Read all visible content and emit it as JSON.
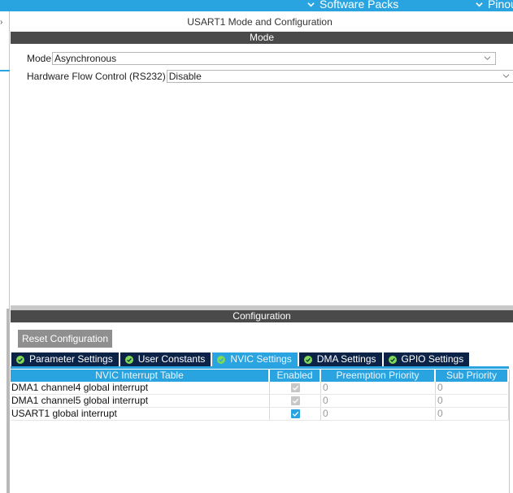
{
  "topbar": {
    "menu1": "Software Packs",
    "menu2": "Pinout",
    "accent": "#2aa4e0"
  },
  "panel": {
    "title": "USART1 Mode and Configuration",
    "mode_header": "Mode",
    "config_header": "Configuration"
  },
  "mode": {
    "mode_label": "Mode",
    "mode_value": "Asynchronous",
    "hfc_label": "Hardware Flow Control (RS232)",
    "hfc_value": "Disable"
  },
  "config": {
    "reset_label": "Reset Configuration",
    "tabs": [
      {
        "label": "Parameter Settings",
        "active": false
      },
      {
        "label": "User Constants",
        "active": false
      },
      {
        "label": "NVIC Settings",
        "active": true
      },
      {
        "label": "DMA Settings",
        "active": false
      },
      {
        "label": "GPIO Settings",
        "active": false
      }
    ]
  },
  "nvic": {
    "headers": [
      "NVIC Interrupt Table",
      "Enabled",
      "Preemption Priority",
      "Sub Priority"
    ],
    "rows": [
      {
        "name": "DMA1 channel4 global interrupt",
        "enabled": true,
        "editable": false,
        "preemption": "0",
        "sub": "0"
      },
      {
        "name": "DMA1 channel5 global interrupt",
        "enabled": true,
        "editable": false,
        "preemption": "0",
        "sub": "0"
      },
      {
        "name": "USART1 global interrupt",
        "enabled": true,
        "editable": true,
        "preemption": "0",
        "sub": "0"
      }
    ]
  }
}
